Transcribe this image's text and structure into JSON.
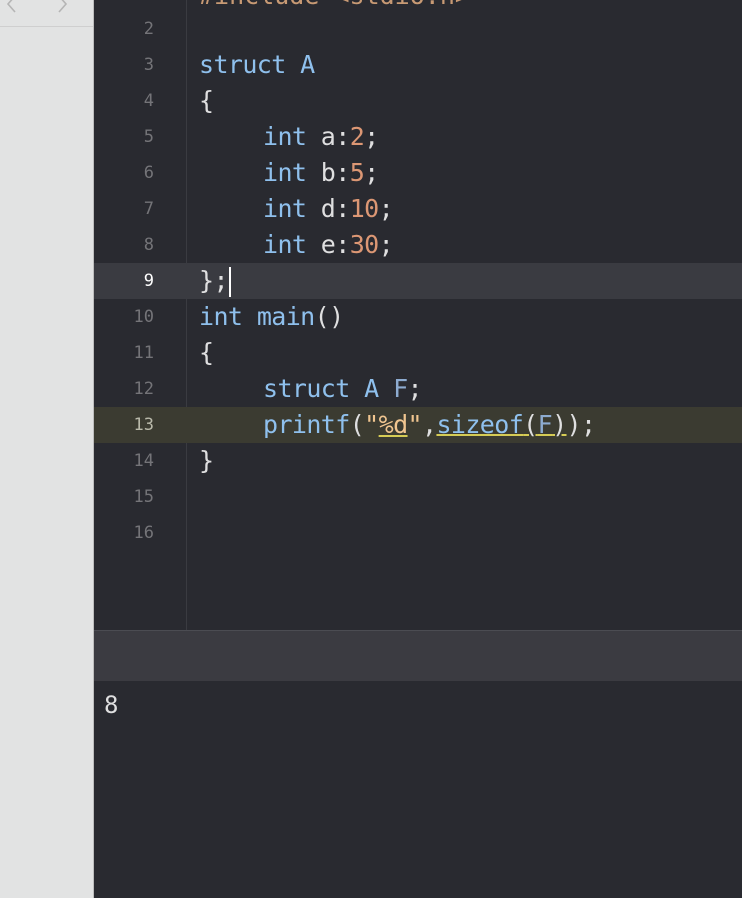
{
  "navigator": {
    "back_icon": "chevron-left-icon",
    "forward_icon": "chevron-right-icon"
  },
  "editor": {
    "clipped_top_line": "#include <stdio.h>",
    "lines": [
      {
        "n": "2",
        "t": ""
      },
      {
        "n": "3",
        "t": "struct A"
      },
      {
        "n": "4",
        "t": "{"
      },
      {
        "n": "5",
        "t": "int a:2;"
      },
      {
        "n": "6",
        "t": "int b:5;"
      },
      {
        "n": "7",
        "t": "int d:10;"
      },
      {
        "n": "8",
        "t": "int e:30;"
      },
      {
        "n": "9",
        "t": "};"
      },
      {
        "n": "10",
        "t": "int main()"
      },
      {
        "n": "11",
        "t": "{"
      },
      {
        "n": "12",
        "t": "struct A F;"
      },
      {
        "n": "13",
        "t": "printf(\"%d\",sizeof(F));"
      },
      {
        "n": "14",
        "t": "}"
      },
      {
        "n": "15",
        "t": ""
      },
      {
        "n": "16",
        "t": ""
      }
    ],
    "current_line": "9",
    "warning_line": "13"
  },
  "console": {
    "output": "8"
  },
  "colors": {
    "background": "#292a30",
    "keyword": "#8fc0ed",
    "number": "#dc9774",
    "string": "#f0c590",
    "plain": "#dfdfe0",
    "gutter_text": "#747478",
    "warning_underline": "#d6cc55"
  }
}
